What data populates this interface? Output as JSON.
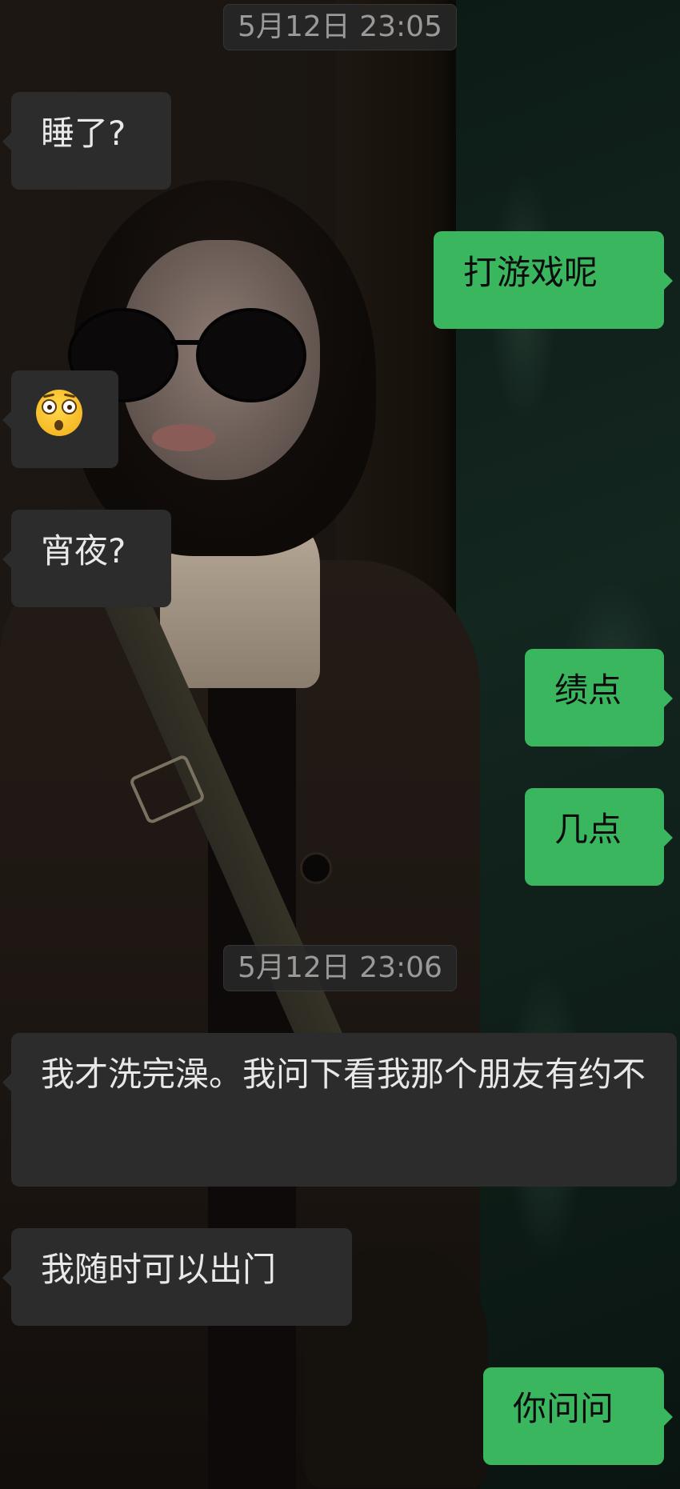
{
  "chat": {
    "messages": [
      {
        "kind": "time",
        "text": "5月12日 23:05"
      },
      {
        "kind": "msg",
        "side": "in",
        "text": "睡了?"
      },
      {
        "kind": "msg",
        "side": "out",
        "text": "打游戏呢"
      },
      {
        "kind": "msg",
        "side": "in",
        "emoji": "flushed-face-emoji",
        "text": ""
      },
      {
        "kind": "msg",
        "side": "in",
        "text": "宵夜?"
      },
      {
        "kind": "msg",
        "side": "out",
        "text": "绩点"
      },
      {
        "kind": "msg",
        "side": "out",
        "text": "几点"
      },
      {
        "kind": "time",
        "text": "5月12日 23:06"
      },
      {
        "kind": "msg",
        "side": "in",
        "text": "我才洗完澡。我问下看我那个朋友有约不"
      },
      {
        "kind": "msg",
        "side": "in",
        "text": "我随时可以出门"
      },
      {
        "kind": "msg",
        "side": "out",
        "text": "你问问"
      }
    ]
  },
  "colors": {
    "incoming_bubble": "#2c2c2c",
    "outgoing_bubble": "#3ab75e",
    "incoming_text": "#e8e8e8",
    "outgoing_text": "#0c0c0c",
    "timestamp_text": "#9a9a9a"
  }
}
